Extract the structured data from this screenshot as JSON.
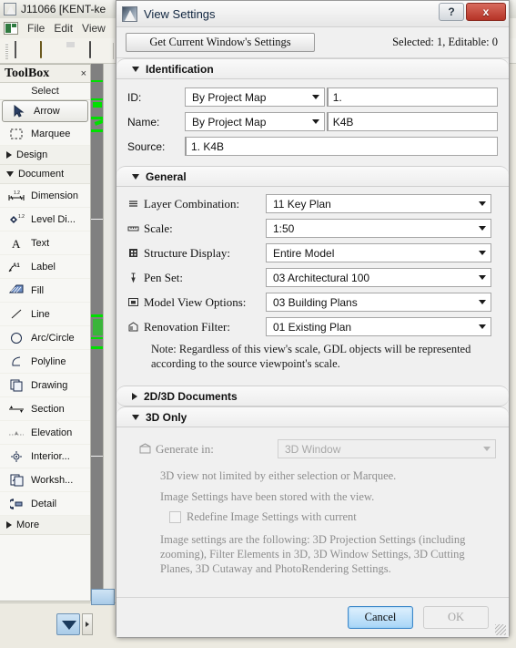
{
  "app": {
    "title": "J11066 [KENT-ke",
    "menu": [
      "File",
      "Edit",
      "View"
    ],
    "toolbar_icons": [
      "new-document-icon",
      "open-folder-icon",
      "save-disk-icon",
      "print-icon"
    ]
  },
  "toolbox": {
    "title": "ToolBox",
    "close_label": "×",
    "subheader": "Select",
    "items": [
      {
        "label": "Arrow",
        "icon": "arrow-cursor-icon",
        "type": "tool",
        "selected": true
      },
      {
        "label": "Marquee",
        "icon": "marquee-icon",
        "type": "tool",
        "selected": false
      },
      {
        "label": "Design",
        "icon": "triangle-right-icon",
        "type": "group",
        "expanded": false
      },
      {
        "label": "Document",
        "icon": "triangle-down-icon",
        "type": "group",
        "expanded": true
      },
      {
        "label": "Dimension",
        "icon": "dimension-icon",
        "type": "tool",
        "selected": false
      },
      {
        "label": "Level Di...",
        "icon": "level-dimension-icon",
        "type": "tool",
        "selected": false
      },
      {
        "label": "Text",
        "icon": "text-icon",
        "type": "tool",
        "selected": false
      },
      {
        "label": "Label",
        "icon": "label-icon",
        "type": "tool",
        "selected": false
      },
      {
        "label": "Fill",
        "icon": "fill-icon",
        "type": "tool",
        "selected": false
      },
      {
        "label": "Line",
        "icon": "line-icon",
        "type": "tool",
        "selected": false
      },
      {
        "label": "Arc/Circle",
        "icon": "arc-circle-icon",
        "type": "tool",
        "selected": false
      },
      {
        "label": "Polyline",
        "icon": "polyline-icon",
        "type": "tool",
        "selected": false
      },
      {
        "label": "Drawing",
        "icon": "drawing-icon",
        "type": "tool",
        "selected": false
      },
      {
        "label": "Section",
        "icon": "section-icon",
        "type": "tool",
        "selected": false
      },
      {
        "label": "Elevation",
        "icon": "elevation-icon",
        "type": "tool",
        "selected": false
      },
      {
        "label": "Interior...",
        "icon": "interior-elevation-icon",
        "type": "tool",
        "selected": false
      },
      {
        "label": "Worksh...",
        "icon": "worksheet-icon",
        "type": "tool",
        "selected": false
      },
      {
        "label": "Detail",
        "icon": "detail-icon",
        "type": "tool",
        "selected": false
      },
      {
        "label": "More",
        "icon": "triangle-right-icon",
        "type": "group",
        "expanded": false
      }
    ]
  },
  "dialog": {
    "title": "View Settings",
    "icon": "view-settings-icon",
    "window_buttons": {
      "help": "?",
      "close": "x"
    },
    "get_settings_button": "Get Current Window's Settings",
    "selected_info": "Selected: 1, Editable: 0",
    "identification": {
      "header": "Identification",
      "expanded": true,
      "id_label": "ID:",
      "id_mode": "By Project Map",
      "id_value": "1.",
      "name_label": "Name:",
      "name_mode": "By Project Map",
      "name_value": "K4B",
      "source_label": "Source:",
      "source_value": "1. K4B"
    },
    "general": {
      "header": "General",
      "expanded": true,
      "rows": [
        {
          "label": "Layer Combination:",
          "value": "11 Key Plan",
          "icon": "layers-icon"
        },
        {
          "label": "Scale:",
          "value": "1:50",
          "icon": "scale-ruler-icon"
        },
        {
          "label": "Structure Display:",
          "value": "Entire Model",
          "icon": "structure-grid-icon"
        },
        {
          "label": "Pen Set:",
          "value": "03 Architectural 100",
          "icon": "pen-icon"
        },
        {
          "label": "Model View Options:",
          "value": "03 Building Plans",
          "icon": "model-view-icon"
        },
        {
          "label": "Renovation Filter:",
          "value": "01 Existing Plan",
          "icon": "renovation-icon"
        }
      ],
      "note": "Note: Regardless of this view's scale, GDL objects will be represented according to the source viewpoint's scale."
    },
    "documents_2d3d": {
      "header": "2D/3D Documents",
      "expanded": false
    },
    "three_d_only": {
      "header": "3D Only",
      "expanded": true,
      "generate_in_label": "Generate in:",
      "generate_in_icon": "generate-in-icon",
      "generate_in_value": "3D Window",
      "generate_in_disabled": true,
      "info_line_1": "3D view not limited by either selection or Marquee.",
      "info_line_2": "Image Settings have been stored with the view.",
      "checkbox_label": "Redefine Image Settings with current",
      "checkbox_checked": false,
      "info_line_3": "Image settings are the following: 3D Projection Settings (including zooming), Filter Elements in 3D, 3D Window Settings, 3D Cutting Planes, 3D Cutaway and PhotoRendering Settings."
    },
    "footer": {
      "cancel": "Cancel",
      "ok": "OK",
      "ok_disabled": true
    }
  },
  "colors": {
    "dialog_bg": "#f0f0f0",
    "close_button": "#b53326",
    "cancel_accent": "#3c87c9",
    "canvas_bg": "#808080",
    "cad_green": "#00e000"
  }
}
